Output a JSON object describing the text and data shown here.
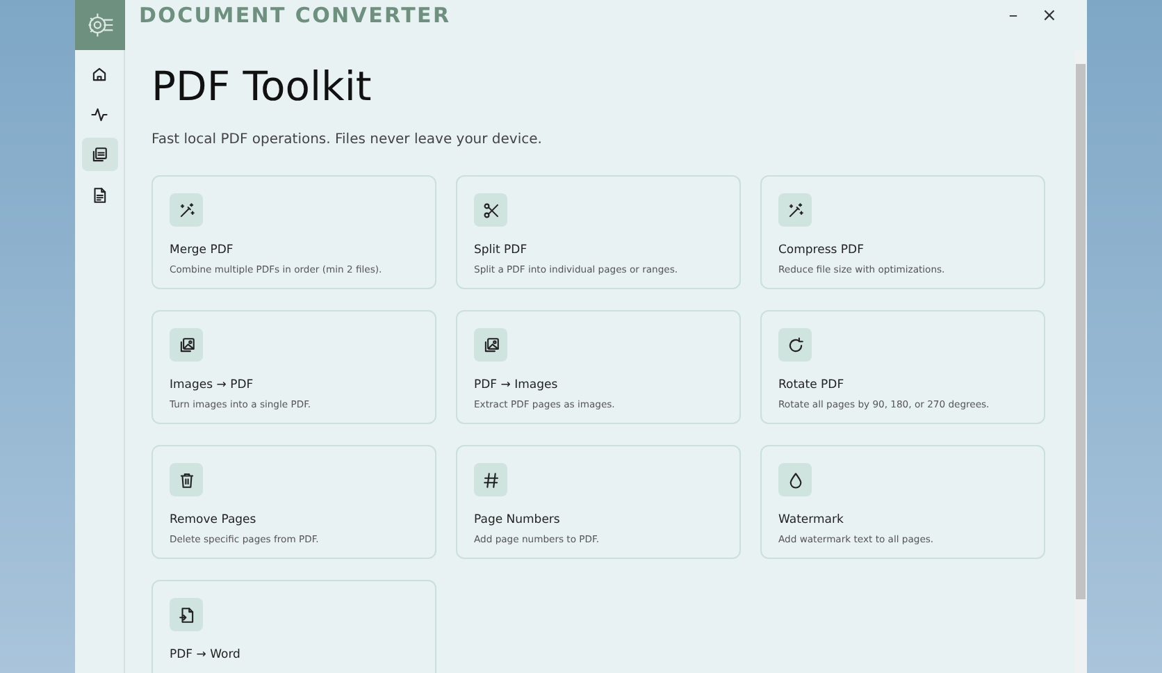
{
  "app": {
    "title": "DOCUMENT CONVERTER"
  },
  "window_controls": [
    "–",
    "×"
  ],
  "sidebar": {
    "items": [
      {
        "selected": false
      },
      {
        "selected": false
      },
      {
        "selected": true
      },
      {
        "selected": false
      }
    ]
  },
  "page": {
    "title": "PDF Toolkit",
    "subtitle": "Fast local PDF operations. Files never leave your device."
  },
  "tools": [
    {
      "title": "Merge PDF",
      "description": "Combine multiple PDFs in order (min 2 files)."
    },
    {
      "title": "Split PDF",
      "description": "Split a PDF into individual pages or ranges."
    },
    {
      "title": "Compress PDF",
      "description": "Reduce file size with optimizations."
    },
    {
      "title": "Images → PDF",
      "description": "Turn images into a single PDF."
    },
    {
      "title": "PDF → Images",
      "description": "Extract PDF pages as images."
    },
    {
      "title": "Rotate PDF",
      "description": "Rotate all pages by 90, 180, or 270 degrees."
    },
    {
      "title": "Remove Pages",
      "description": "Delete specific pages from PDF."
    },
    {
      "title": "Page Numbers",
      "description": "Add page numbers to PDF."
    },
    {
      "title": "Watermark",
      "description": "Add watermark text to all pages."
    },
    {
      "title": "PDF → Word"
    }
  ]
}
